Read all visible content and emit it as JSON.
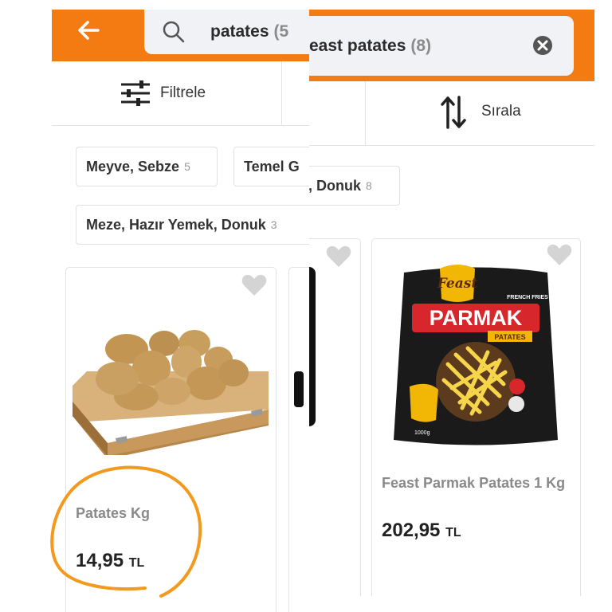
{
  "left": {
    "search_query": "patates",
    "search_count": "(5",
    "filter_label": "Filtrele",
    "chips": [
      {
        "label": "Meyve, Sebze",
        "count": "5"
      },
      {
        "label": "Temel G",
        "count": ""
      },
      {
        "label": "Meze, Hazır Yemek, Donuk",
        "count": "3"
      }
    ],
    "product": {
      "name": "Patates Kg",
      "price": "14,95",
      "currency": "TL"
    }
  },
  "right": {
    "search_query": "east patates",
    "search_count": "(8)",
    "sort_label": "Sırala",
    "chips": [
      {
        "label": "k, Donuk",
        "count": "8"
      }
    ],
    "product": {
      "name": "Feast Parmak Patates 1 Kg",
      "price": "202,95",
      "currency": "TL",
      "bag_brand": "Feast",
      "bag_subtitle": "FRENCH FRIES",
      "bag_title": "PARMAK",
      "bag_ribbon": "PATATES",
      "bag_weight": "1000g"
    }
  },
  "colors": {
    "accent": "#f47a12",
    "circle": "#f39a1e"
  }
}
